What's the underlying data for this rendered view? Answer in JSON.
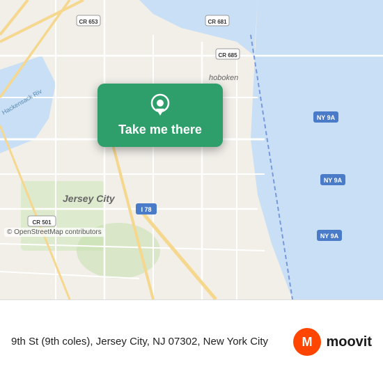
{
  "map": {
    "alt": "Map of Jersey City, NJ area"
  },
  "callout": {
    "label": "Take me there",
    "icon_alt": "location-pin"
  },
  "osm_credit": "© OpenStreetMap contributors",
  "address": {
    "text": "9th St (9th coles), Jersey City, NJ 07302, New York City"
  },
  "moovit": {
    "name": "moovit"
  }
}
